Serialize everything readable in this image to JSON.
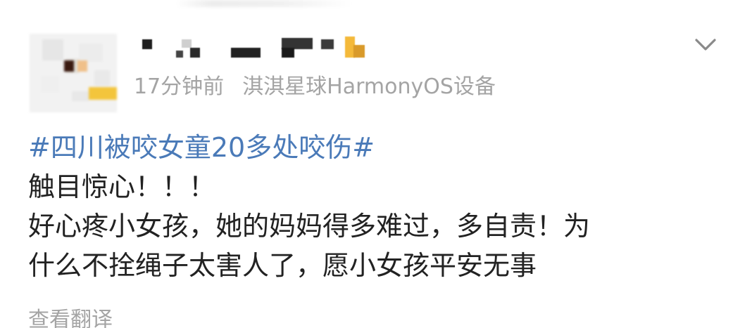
{
  "post": {
    "meta": {
      "time": "17分钟前",
      "device": "淇淇星球HarmonyOS设备"
    },
    "hashtag": "#四川被咬女童20多处咬伤#",
    "lines": [
      "触目惊心！！！",
      "好心疼小女孩，她的妈妈得多难过，多自责！为",
      "什么不拴绳子太害人了，愿小女孩平安无事"
    ],
    "translate_label": "查看翻译",
    "icons": {
      "more": "chevron-down-icon"
    },
    "colors": {
      "hashtag": "#4a7ab8",
      "meta": "#a4a4a4",
      "text": "#222222"
    }
  }
}
